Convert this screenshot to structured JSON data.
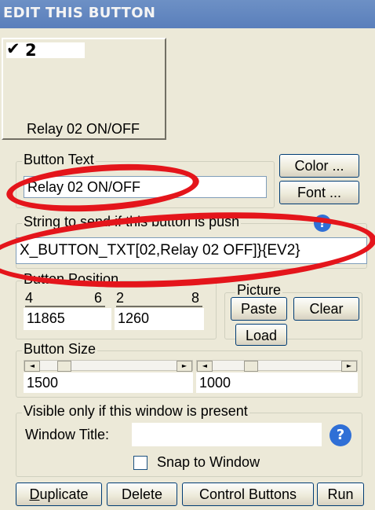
{
  "window": {
    "title": "EDIT THIS BUTTON"
  },
  "preview": {
    "check_label": "2",
    "text": "Relay 02 ON/OFF"
  },
  "button_text": {
    "legend": "Button Text",
    "value": "Relay 02 ON/OFF",
    "color_label": "Color ...",
    "font_label": "Font ..."
  },
  "string_to_send": {
    "legend": "String to send if this button is push",
    "value": "X_BUTTON_TXT[02,Relay 02 OFF]}{EV2}"
  },
  "button_position": {
    "legend": "Button Position",
    "scale_labels": [
      "4",
      "6",
      "2",
      "8"
    ],
    "x_value": "11865",
    "y_value": "1260"
  },
  "picture": {
    "legend": "Picture",
    "paste_label": "Paste",
    "clear_label": "Clear",
    "load_label": "Load"
  },
  "button_size": {
    "legend": "Button Size",
    "width_value": "1500",
    "height_value": "1000"
  },
  "visible_only": {
    "legend": "Visible only if this window is present",
    "window_title_label": "Window Title:",
    "window_title_value": "",
    "snap_label": "Snap to Window",
    "snap_checked": false
  },
  "footer": {
    "duplicate_label": "Duplicate",
    "delete_label": "Delete",
    "control_buttons_label": "Control Buttons",
    "run_label": "Run"
  },
  "colors": {
    "titlebar": "#5a7fbb",
    "annotation_red": "#e4151b",
    "help_blue": "#2f6fd6"
  }
}
